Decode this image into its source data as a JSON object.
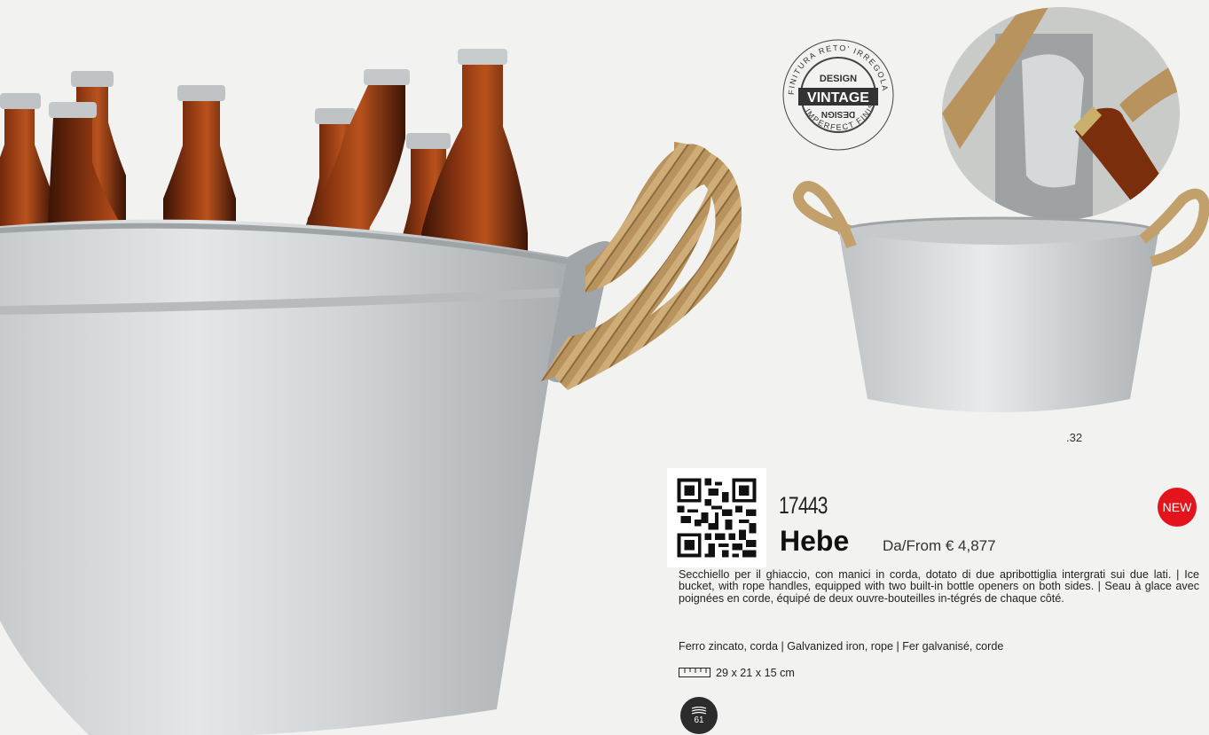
{
  "stamp": {
    "top_text": "FINITURA RETO' IRREGOLARE",
    "bottom_text": "IMPERFECT FINISH",
    "design_top": "DESIGN",
    "vintage": "VINTAGE",
    "design_bottom": "DESIGN"
  },
  "page_ref": ".32",
  "product": {
    "code": "17443",
    "name": "Hebe",
    "price": "Da/From € 4,877",
    "badge": "NEW",
    "description": "Secchiello per il ghiaccio, con manici in corda, dotato di due apribottiglia intergrati sui due lati.  | Ice bucket, with rope handles, equipped with two built-in bottle openers on both sides. | Seau à glace avec poignées en corde, équipé de deux ouvre-bouteilles in-tégrés de chaque côté.",
    "material": "Ferro zincato, corda | Galvanized iron, rope | Fer galvanisé, corde",
    "dimensions": "29 x 21 x 15 cm",
    "pack_qty": "61"
  },
  "colors": {
    "background": "#f2f2f1",
    "badge_red": "#e3141c",
    "qty_badge": "#2c2c2c"
  }
}
